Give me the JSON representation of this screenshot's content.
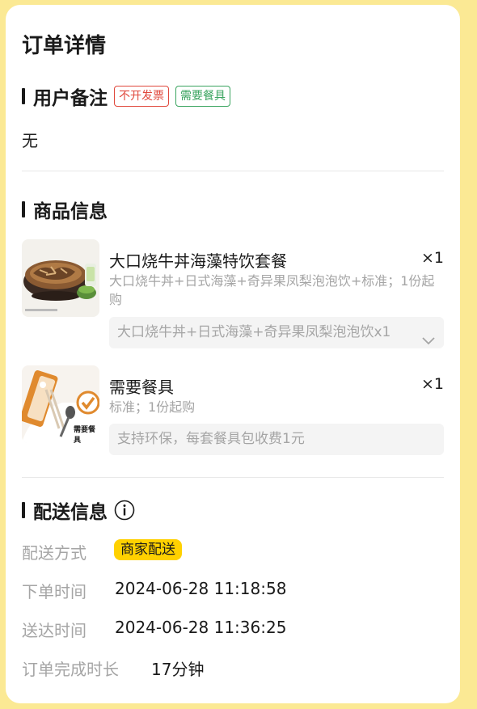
{
  "page": {
    "title": "订单详情"
  },
  "remark": {
    "title": "用户备注",
    "tags": [
      "不开发票",
      "需要餐具"
    ],
    "content": "无"
  },
  "goods": {
    "title": "商品信息",
    "items": [
      {
        "name": "大口烧牛丼海藻特饮套餐",
        "qty": "×1",
        "spec": "大口烧牛丼+日式海藻+奇异果凤梨泡泡饮+标准；1份起购",
        "detail": "大口烧牛丼+日式海藻+奇异果凤梨泡泡饮x1",
        "thumb_icon": "beef-bowl-image"
      },
      {
        "name": "需要餐具",
        "qty": "×1",
        "spec": "标准；1份起购",
        "detail": "支持环保，每套餐具包收费1元",
        "thumb_icon": "tableware-image",
        "thumb_label": "需要餐具"
      }
    ]
  },
  "delivery": {
    "title": "配送信息",
    "method_label": "配送方式",
    "method_value": "商家配送",
    "order_time_label": "下单时间",
    "order_time_value": "2024-06-28 11:18:58",
    "arrive_time_label": "送达时间",
    "arrive_time_value": "2024-06-28 11:36:25",
    "duration_label": "订单完成时长",
    "duration_value": "17分钟"
  },
  "colors": {
    "background": "#fbe994",
    "tag_red": "#e0483c",
    "tag_green": "#3aa45f",
    "badge_yellow": "#ffd100"
  }
}
